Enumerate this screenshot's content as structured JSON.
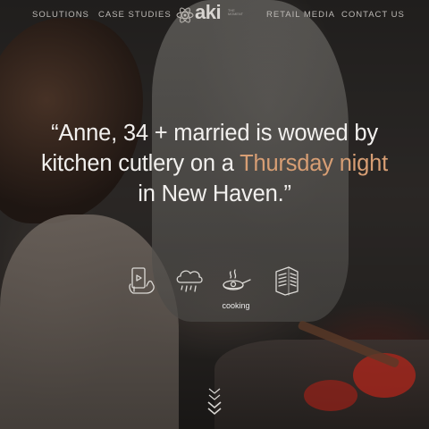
{
  "nav": {
    "left_links": [
      {
        "label": "SOLUTIONS"
      },
      {
        "label": "CASE STUDIES"
      }
    ],
    "right_links": [
      {
        "label": "RETAIL MEDIA"
      },
      {
        "label": "CONTACT US"
      }
    ],
    "logo": {
      "text": "aki",
      "tagline": "THE MOMENT",
      "icon": "atom-icon"
    }
  },
  "hero": {
    "quote_before": "“Anne, 34 + married is wowed by kitchen cutlery on a ",
    "quote_highlight": "Thursday night",
    "quote_after": " in New Haven.”",
    "highlight_color": "#d79e74"
  },
  "moment_icons": [
    {
      "icon": "mobile-hand-icon"
    },
    {
      "icon": "rain-cloud-icon"
    },
    {
      "icon": "cooking-pan-icon",
      "label": "cooking"
    },
    {
      "icon": "building-icon"
    }
  ],
  "scroll_indicator": {
    "icon": "chevrons-down-icon"
  }
}
